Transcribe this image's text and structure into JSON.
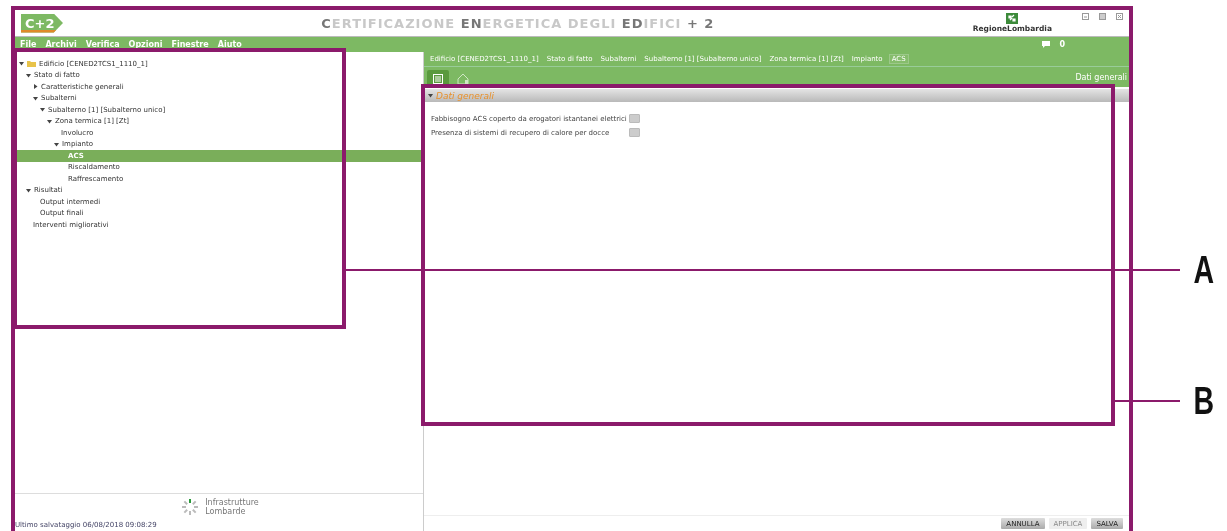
{
  "header": {
    "logo": "C+2",
    "title": "**C**ERTIFICAZIONE **EN**ERGETICA DEGLI **ED**IFICI **+ 2**",
    "partner_logo": "RegioneLombardia"
  },
  "menu": [
    "File",
    "Archivi",
    "Verifica",
    "Opzioni",
    "Finestre",
    "Aiuto"
  ],
  "messages": {
    "count": "0"
  },
  "tree": [
    {
      "label": "Edificio [CENED2TCS1_1110_1]",
      "kind": "root",
      "expanded": true,
      "selected": false,
      "children": [
        {
          "label": "Stato di fatto",
          "kind": "folder",
          "expanded": true,
          "selected": false,
          "children": [
            {
              "label": "Caratteristiche generali",
              "kind": "folder",
              "expanded": false,
              "selected": false
            },
            {
              "label": "Subalterni",
              "kind": "folder",
              "expanded": true,
              "selected": false,
              "children": [
                {
                  "label": "Subalterno [1] [Subalterno unico]",
                  "kind": "folder",
                  "expanded": true,
                  "selected": false,
                  "children": [
                    {
                      "label": "Zona termica [1] [Zt]",
                      "kind": "folder",
                      "expanded": true,
                      "selected": false,
                      "children": [
                        {
                          "label": "Involucro",
                          "kind": "leaf",
                          "selected": false
                        },
                        {
                          "label": "Impianto",
                          "kind": "folder",
                          "expanded": true,
                          "selected": false,
                          "children": [
                            {
                              "label": "ACS",
                              "kind": "leaf",
                              "selected": true
                            },
                            {
                              "label": "Riscaldamento",
                              "kind": "leaf",
                              "selected": false
                            },
                            {
                              "label": "Raffrescamento",
                              "kind": "leaf",
                              "selected": false
                            }
                          ]
                        }
                      ]
                    }
                  ]
                }
              ]
            }
          ]
        },
        {
          "label": "Risultati",
          "kind": "folder",
          "expanded": true,
          "selected": false,
          "children": [
            {
              "label": "Output intermedi",
              "kind": "leaf",
              "selected": false
            },
            {
              "label": "Output finali",
              "kind": "leaf",
              "selected": false
            }
          ]
        },
        {
          "label": "Interventi migliorativi",
          "kind": "leaf",
          "selected": false
        }
      ]
    }
  ],
  "footer_logo": {
    "line1": "Infrastrutture",
    "line2": "Lombarde"
  },
  "status_bar": "Ultimo salvataggio 06/08/2018 09:08:29",
  "breadcrumb": [
    {
      "label": "Edificio [CENED2TCS1_1110_1]",
      "selected": false
    },
    {
      "label": "Stato di fatto",
      "selected": false
    },
    {
      "label": "Subalterni",
      "selected": false
    },
    {
      "label": "Subalterno [1] [Subalterno unico]",
      "selected": false
    },
    {
      "label": "Zona termica [1] [Zt]",
      "selected": false
    },
    {
      "label": "Impianto",
      "selected": false
    },
    {
      "label": "ACS",
      "selected": true
    }
  ],
  "tabs": [
    {
      "kind": "form",
      "selected": true
    },
    {
      "kind": "house",
      "selected": false
    }
  ],
  "tab_caption": "Dati generali",
  "section": {
    "title": "Dati generali",
    "expanded": true,
    "fields": [
      {
        "label": "Fabbisogno ACS coperto da erogatori istantanei elettrici",
        "checked": false
      },
      {
        "label": "Presenza di sistemi di recupero di calore per docce",
        "checked": false
      }
    ]
  },
  "buttons": [
    {
      "label": "ANNULLA",
      "disabled": false
    },
    {
      "label": "APPLICA",
      "disabled": true
    },
    {
      "label": "SALVA",
      "disabled": false
    }
  ],
  "annotations": [
    {
      "label": "A"
    },
    {
      "label": "B"
    }
  ]
}
